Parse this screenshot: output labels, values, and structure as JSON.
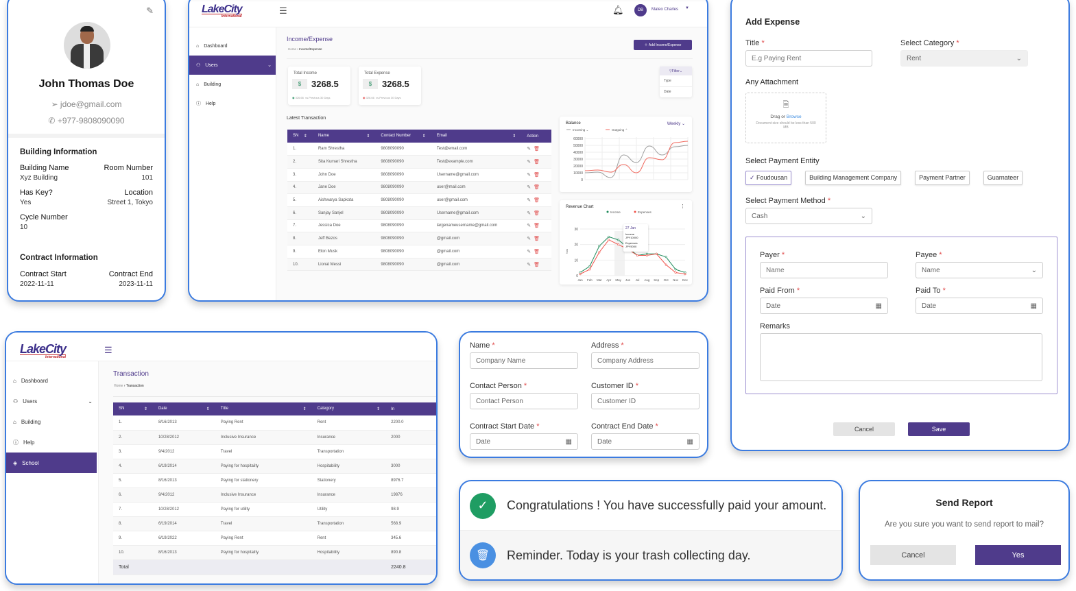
{
  "profile": {
    "name": "John Thomas Doe",
    "email": "jdoe@gmail.com",
    "phone": "+977-9808090090",
    "building_title": "Building Information",
    "fields": [
      [
        "Building Name",
        "Xyz Building"
      ],
      [
        "Room Number",
        "101"
      ],
      [
        "Has Key?",
        "Yes"
      ],
      [
        "Location",
        "Street 1, Tokyo"
      ],
      [
        "Cycle Number",
        "10"
      ]
    ],
    "contract_title": "Contract Information",
    "contract": [
      [
        "Contract Start",
        "2022-11-11"
      ],
      [
        "Contract End",
        "2023-11-11"
      ]
    ]
  },
  "brand": {
    "logo": "LakeCity",
    "logo_sub": "International",
    "accent": "#4f3b8b"
  },
  "dashboard": {
    "user": {
      "initials": "DB",
      "name": "Mateo Charles"
    },
    "sidebar": [
      "Dashboard",
      "Users",
      "Building",
      "Help"
    ],
    "title": "Income/Expense",
    "breadcrumb": [
      "Home",
      "Income/Expense"
    ],
    "add_button": "Add Income/Expense",
    "income": {
      "label": "Total Income",
      "value": "3268.5",
      "delta": "326.66",
      "note": "vs.Previous 30 Days"
    },
    "expense": {
      "label": "Total Expense",
      "value": "3268.5",
      "delta": "326.66",
      "note": "vs.Previous 30 Days"
    },
    "filter": {
      "label": "Filter",
      "options": [
        "Type",
        "Date"
      ]
    },
    "latest_title": "Latest Transaction",
    "columns": [
      "SN",
      "Name",
      "Contact Number",
      "Email",
      "Action"
    ],
    "rows": [
      [
        "1.",
        "Ram Shrestha",
        "9808090090",
        "Test@email.com"
      ],
      [
        "2.",
        "Sita Kumari Shrestha",
        "9808090090",
        "Test@example.com"
      ],
      [
        "3.",
        "John Doe",
        "9808090090",
        "Username@gmail.com"
      ],
      [
        "4.",
        "Jane Doe",
        "9808090090",
        "user@mail.com"
      ],
      [
        "5.",
        "Aishwarya Sapkota",
        "9808090090",
        "user@gmail.com"
      ],
      [
        "6.",
        "Sanjay Sanjel",
        "9808090090",
        "Username@gmail.com"
      ],
      [
        "7.",
        "Jessica Doe",
        "9808090090",
        "largenameusername@gmail.com"
      ],
      [
        "8.",
        "Jeff Bezos",
        "9808090090",
        "@gmail.com"
      ],
      [
        "9.",
        "Elon Musk",
        "9808090090",
        "@gmail.com"
      ],
      [
        "10.",
        "Lional Messi",
        "9808090090",
        "@gmail.com"
      ]
    ]
  },
  "chart_data": [
    {
      "type": "line",
      "title": "Balance",
      "period": "Weekly",
      "ylim": [
        0,
        60000
      ],
      "yticks": [
        0,
        10000,
        20000,
        30000,
        40000,
        50000,
        60000
      ],
      "grid": true,
      "legend": "top-left",
      "series": [
        {
          "name": "Incoming",
          "color": "#9e9e9e",
          "values": [
            10000,
            11000,
            3000,
            36000,
            25000,
            49000,
            36000,
            48000,
            50000
          ]
        },
        {
          "name": "Outgoing",
          "color": "#f06a5f",
          "values": [
            13000,
            14000,
            11000,
            22000,
            10000,
            32000,
            29000,
            54000,
            56000
          ]
        }
      ]
    },
    {
      "type": "line",
      "title": "Revenue Chart",
      "ylabel": "Nos",
      "ylim": [
        0,
        30
      ],
      "yticks": [
        0,
        10,
        20,
        30
      ],
      "legend": "top",
      "categories": [
        "Jan",
        "Feb",
        "Mar",
        "Apr",
        "May",
        "Jun",
        "Jul",
        "Aug",
        "Sep",
        "Oct",
        "Nov",
        "Dec"
      ],
      "series": [
        {
          "name": "Income",
          "color": "#1f8a5b",
          "values": [
            2,
            6,
            19,
            25,
            23,
            18,
            13,
            14,
            14,
            12,
            4,
            2
          ]
        },
        {
          "name": "Expenses",
          "color": "#f0524a",
          "values": [
            1,
            4,
            15,
            23,
            20,
            17,
            13,
            13,
            14,
            7,
            2,
            1
          ]
        }
      ],
      "tooltip": {
        "date": "27 Jan",
        "income_label": "Income",
        "income": "JPY10000",
        "expense_label": "Expenses",
        "expense": "JPY5000"
      }
    }
  ],
  "expense_form": {
    "title": "Add Expense",
    "title_label": "Title",
    "title_placeholder": "E.g Paying Rent",
    "category_label": "Select Category",
    "category": "Rent",
    "attachment_label": "Any Attachment",
    "drag": "Drag or",
    "browse": "Browse",
    "size_note": "Document size should be less than 500 MB",
    "entity_label": "Select Payment Entity",
    "entities": [
      "Foudousan",
      "Building Management Company",
      "Payment Partner",
      "Guarnateer"
    ],
    "method_label": "Select Payment Method",
    "method": "Cash",
    "payer_label": "Payer",
    "payer_ph": "Name",
    "payee_label": "Payee",
    "payee_ph": "Name",
    "paid_from_label": "Paid From",
    "paid_to_label": "Paid To",
    "date_ph": "Date",
    "remarks_label": "Remarks",
    "cancel": "Cancel",
    "save": "Save"
  },
  "transaction": {
    "sidebar": [
      "Dashboard",
      "Users",
      "Building",
      "Help",
      "School"
    ],
    "title": "Transaction",
    "breadcrumb": [
      "Home",
      "Transaction"
    ],
    "columns": [
      "SN",
      "Date",
      "Title",
      "Category",
      "In"
    ],
    "rows": [
      [
        "1.",
        "8/16/2013",
        "Paying Rent",
        "Rent",
        "2200.0"
      ],
      [
        "2.",
        "10/28/2012",
        "Inclusive Insurance",
        "Insurance",
        "2000"
      ],
      [
        "3.",
        "9/4/2012",
        "Travel",
        "Transportation",
        ""
      ],
      [
        "4.",
        "6/19/2014",
        "Paying for hospitality",
        "Hospitability",
        "3000"
      ],
      [
        "5.",
        "8/16/2013",
        "Paying for stationery",
        "Stationery",
        "8976.7"
      ],
      [
        "6.",
        "9/4/2012",
        "Inclusive Insurance",
        "Insurance",
        "19876"
      ],
      [
        "7.",
        "10/28/2012",
        "Paying for utility",
        "Utility",
        "98.9"
      ],
      [
        "8.",
        "6/19/2014",
        "Travel",
        "Transportation",
        "568.9"
      ],
      [
        "9.",
        "6/19/2022",
        "Paying Rent",
        "Rent",
        "345.6"
      ],
      [
        "10.",
        "8/16/2013",
        "Paying for hospitality",
        "Hospitability",
        "890.8"
      ]
    ],
    "total_label": "Total",
    "total": "2240.8"
  },
  "company_form": {
    "name_label": "Name",
    "name_ph": "Company Name",
    "address_label": "Address",
    "address_ph": "Company Address",
    "contact_label": "Contact Person",
    "contact_ph": "Contact Person",
    "customer_label": "Customer ID",
    "customer_ph": "Customer ID",
    "start_label": "Contract Start Date",
    "end_label": "Contract End Date",
    "date_ph": "Date"
  },
  "notifications": {
    "success": "Congratulations ! You have successfully paid your amount.",
    "reminder": "Reminder. Today is your trash collecting day."
  },
  "report": {
    "title": "Send Report",
    "message": "Are you sure you want to send report to mail?",
    "cancel": "Cancel",
    "yes": "Yes"
  }
}
